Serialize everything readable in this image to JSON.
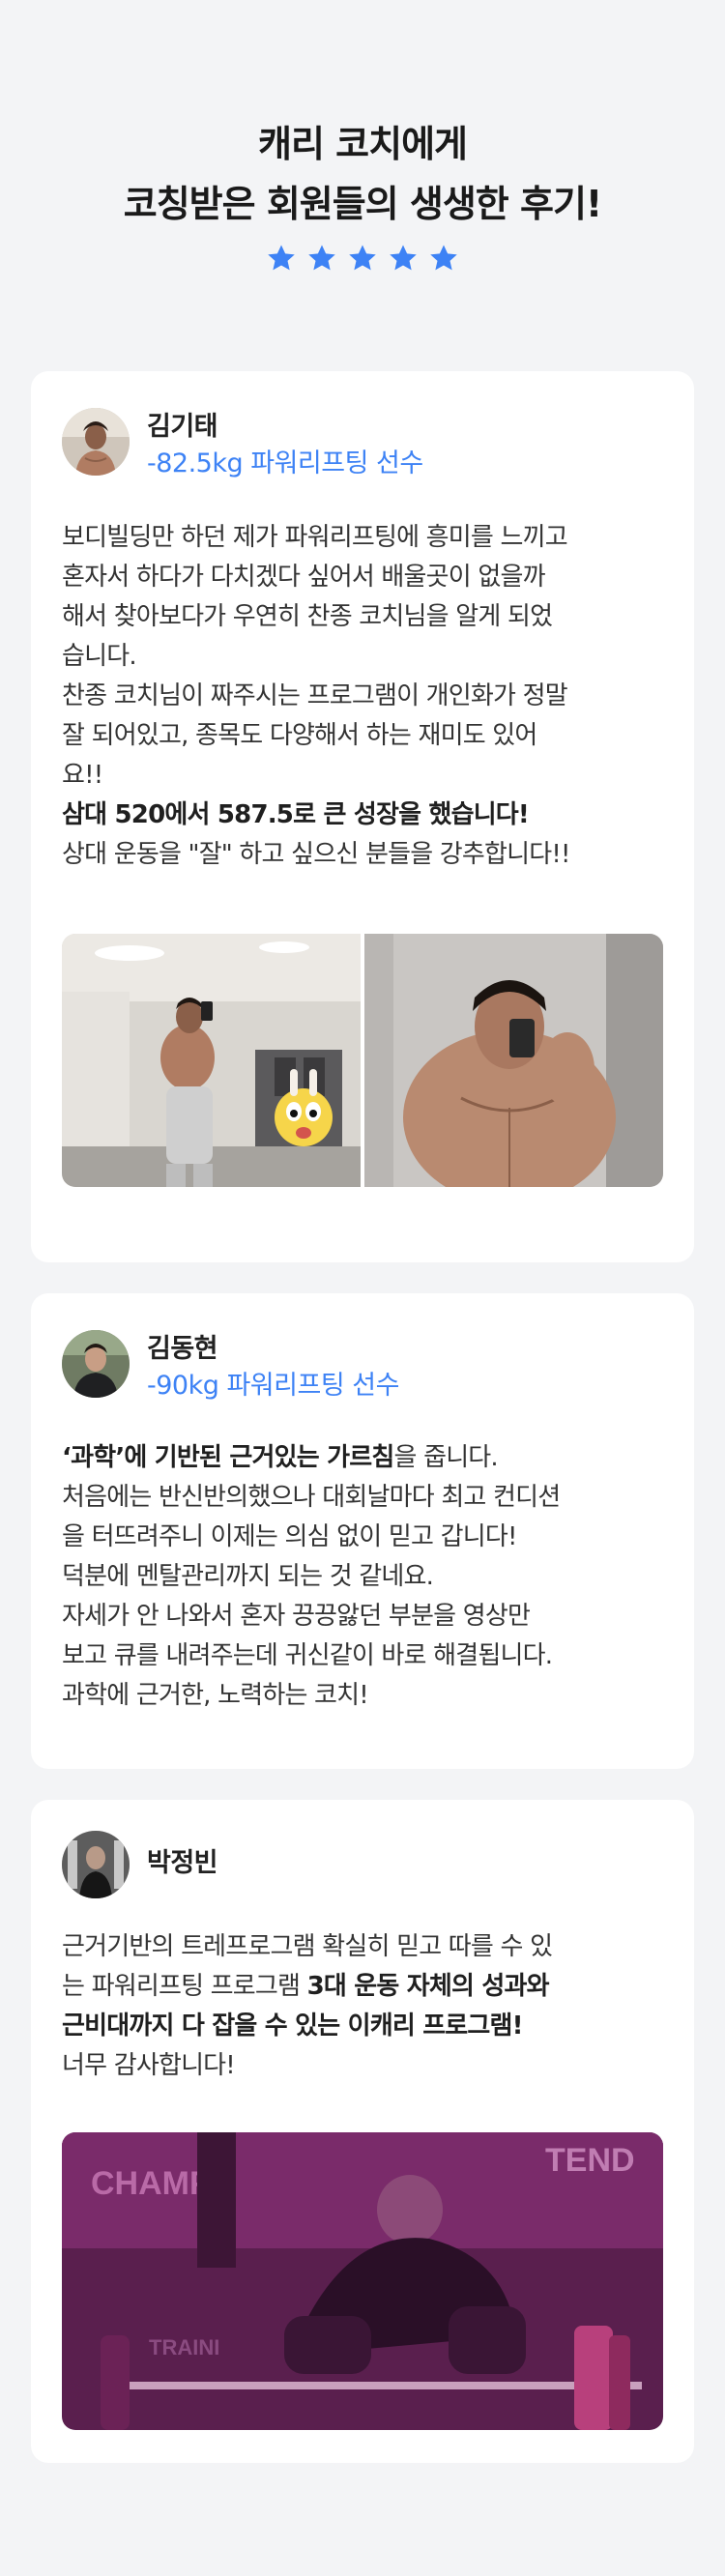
{
  "header": {
    "title_line1": "캐리 코치에게",
    "title_line2": "코칭받은 회원들의 생생한 후기!",
    "rating": 5,
    "star_color": "#3d82f5"
  },
  "reviews": [
    {
      "name": "김기태",
      "role": "-82.5kg 파워리프팅 선수",
      "lines": [
        "보디빌딩만 하던 제가 파워리프팅에 흥미를 느끼고",
        "혼자서 하다가 다치겠다 싶어서 배울곳이 없을까",
        "해서 찾아보다가 우연히 찬종 코치님을 알게 되었",
        "습니다.",
        "찬종 코치님이 짜주시는 프로그램이 개인화가 정말",
        "잘 되어있고, 종목도 다양해서 하는 재미도 있어",
        "요!!"
      ],
      "highlight": "삼대 520에서 587.5로 큰 성장을 했습니다!",
      "closing": "상대 운동을 \"잘\" 하고 싶으신 분들을 강추합니다!!",
      "photo_alt_left": "gym-mirror-selfie",
      "photo_alt_right": "mirror-selfie"
    },
    {
      "name": "김동현",
      "role": "-90kg 파워리프팅 선수",
      "first_bold": "‘과학’에 기반된 근거있는 가르침",
      "first_rest": "을 줍니다.",
      "lines": [
        "처음에는 반신반의했으나 대회날마다 최고 컨디션",
        "을 터뜨려주니 이제는 의심 없이 믿고 갑니다!",
        "덕분에 멘탈관리까지 되는 것 같네요.",
        "자세가 안 나와서 혼자 끙끙앓던 부분을 영상만",
        "보고 큐를 내려주는데 귀신같이 바로 해결됩니다.",
        "과학에 근거한, 노력하는 코치!"
      ]
    },
    {
      "name": "박정빈",
      "line1": "근거기반의 트레프로그램 확실히 믿고 따를 수 있",
      "line2_plain": "는 파워리프팅 프로그램 ",
      "line2_bold": "3대 운동 자체의 성과와",
      "line3_bold": "근비대까지 다 잡을 수 있는 이캐리 프로그램!",
      "line4": "너무 감사합니다!",
      "photo_text_1": "CHAMPI",
      "photo_text_2": "TEND",
      "photo_text_3": "TRAINI"
    }
  ]
}
